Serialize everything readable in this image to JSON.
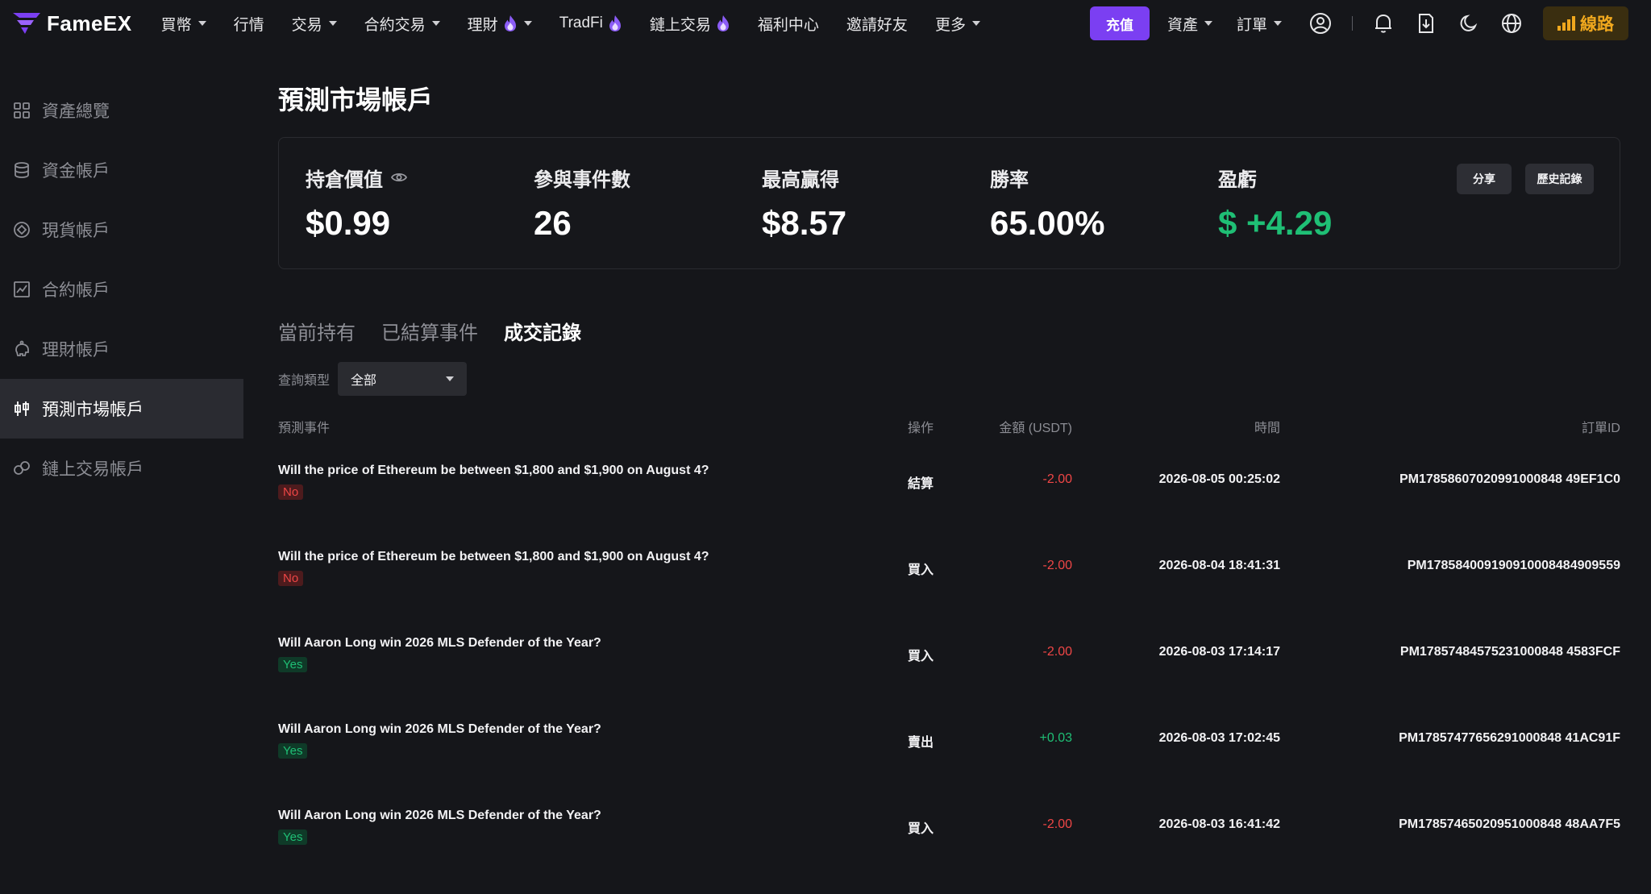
{
  "nav": {
    "logo": "FameEX",
    "items": [
      {
        "label": "買幣",
        "dropdown": true,
        "fire": false
      },
      {
        "label": "行情",
        "dropdown": false,
        "fire": false
      },
      {
        "label": "交易",
        "dropdown": true,
        "fire": false
      },
      {
        "label": "合約交易",
        "dropdown": true,
        "fire": false
      },
      {
        "label": "理財",
        "dropdown": true,
        "fire": true
      },
      {
        "label": "TradFi",
        "dropdown": false,
        "fire": true
      },
      {
        "label": "鏈上交易",
        "dropdown": false,
        "fire": true
      },
      {
        "label": "福利中心",
        "dropdown": false,
        "fire": false
      },
      {
        "label": "邀請好友",
        "dropdown": false,
        "fire": false
      },
      {
        "label": "更多",
        "dropdown": true,
        "fire": false
      }
    ],
    "deposit": "充值",
    "assets": "資產",
    "orders": "訂單",
    "line": "線路",
    "colors": {
      "accent": "#7b3ff2",
      "line": "#f0a81e"
    }
  },
  "sidebar": {
    "items": [
      {
        "label": "資產總覽",
        "icon": "grid-icon",
        "active": false
      },
      {
        "label": "資金帳戶",
        "icon": "database-icon",
        "active": false
      },
      {
        "label": "現貨帳戶",
        "icon": "target-icon",
        "active": false
      },
      {
        "label": "合約帳戶",
        "icon": "chart-icon",
        "active": false
      },
      {
        "label": "理財帳戶",
        "icon": "piggy-icon",
        "active": false
      },
      {
        "label": "預測市場帳戶",
        "icon": "candles-icon",
        "active": true
      },
      {
        "label": "鏈上交易帳戶",
        "icon": "chain-icon",
        "active": false
      }
    ]
  },
  "main": {
    "title": "預測市場帳戶",
    "stats": {
      "position_label": "持倉價值",
      "position_value": "$0.99",
      "events_label": "參與事件數",
      "events_value": "26",
      "max_win_label": "最高贏得",
      "max_win_value": "$8.57",
      "win_rate_label": "勝率",
      "win_rate_value": "65.00%",
      "pnl_label": "盈虧",
      "pnl_value": "$ +4.29",
      "share": "分享",
      "history": "歷史記錄"
    },
    "tabs": [
      "當前持有",
      "已結算事件",
      "成交記錄"
    ],
    "active_tab": 2,
    "filter": {
      "label": "查詢類型",
      "value": "全部"
    },
    "table": {
      "headers": {
        "event": "預測事件",
        "op": "操作",
        "amount": "金額 (USDT)",
        "time": "時間",
        "order_id": "訂單ID"
      },
      "rows": [
        {
          "event": "Will the price of Ethereum be between $1,800 and $1,900 on August 4?",
          "side": "No",
          "op": "結算",
          "amount": "-2.00",
          "time": "2026-08-05 00:25:02",
          "order_id": "PM17858607020991000848 49EF1C0"
        },
        {
          "event": "Will the price of Ethereum be between $1,800 and $1,900 on August 4?",
          "side": "No",
          "op": "買入",
          "amount": "-2.00",
          "time": "2026-08-04 18:41:31",
          "order_id": "PM178584009190910008484909559"
        },
        {
          "event": "Will Aaron Long win 2026 MLS Defender of the Year?",
          "side": "Yes",
          "op": "買入",
          "amount": "-2.00",
          "time": "2026-08-03 17:14:17",
          "order_id": "PM17857484575231000848 4583FCF"
        },
        {
          "event": "Will Aaron Long win 2026 MLS Defender of the Year?",
          "side": "Yes",
          "op": "賣出",
          "amount": "+0.03",
          "time": "2026-08-03 17:02:45",
          "order_id": "PM17857477656291000848 41AC91F"
        },
        {
          "event": "Will Aaron Long win 2026 MLS Defender of the Year?",
          "side": "Yes",
          "op": "買入",
          "amount": "-2.00",
          "time": "2026-08-03 16:41:42",
          "order_id": "PM17857465020951000848 48AA7F5"
        }
      ]
    }
  }
}
